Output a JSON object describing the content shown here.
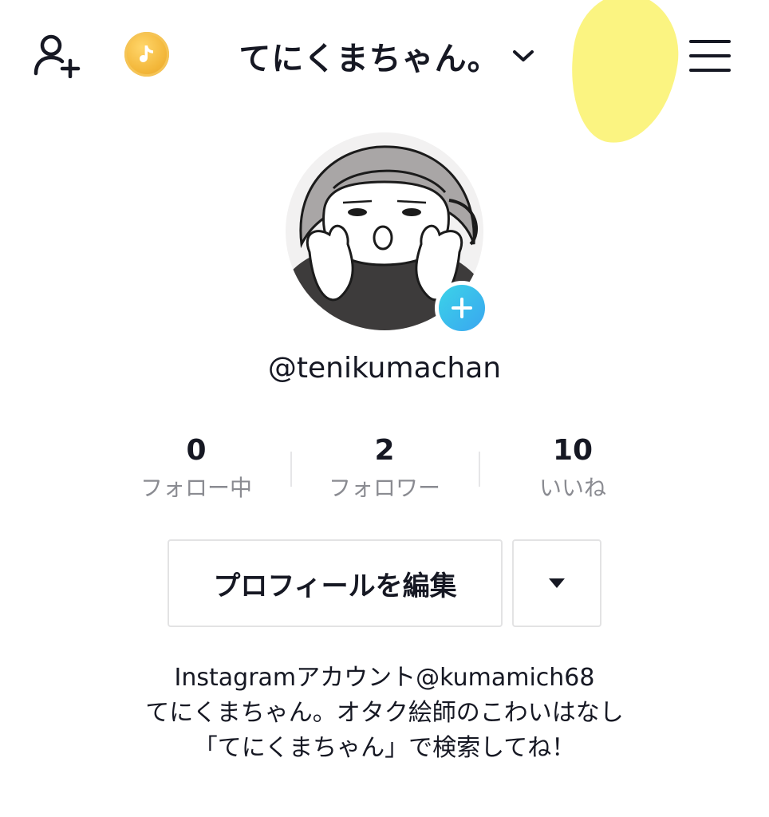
{
  "header": {
    "add_friend_icon": "add-friend-icon",
    "coin_icon": "tiktok-coin-icon",
    "account_name": "てにくまちゃん。",
    "switch_icon": "chevron-down-icon",
    "menu_icon": "hamburger-menu-icon"
  },
  "profile": {
    "avatar_icon": "avatar",
    "add_avatar_icon": "plus-icon",
    "username": "@tenikumachan"
  },
  "stats": [
    {
      "value": "0",
      "label": "フォロー中"
    },
    {
      "value": "2",
      "label": "フォロワー"
    },
    {
      "value": "10",
      "label": "いいね"
    }
  ],
  "actions": {
    "edit_profile_label": "プロフィールを編集",
    "more_icon": "caret-down-icon"
  },
  "bio": {
    "lines": [
      "Instagramアカウント@kumamich68",
      "てにくまちゃん。オタク絵師のこわいはなし",
      "「てにくまちゃん」で検索してね！"
    ]
  },
  "colors": {
    "text": "#161823",
    "muted": "#8a8b91",
    "border": "#e3e3e4",
    "highlight": "#fbf37a",
    "accent": "#3bb8ee",
    "coin": "#f3b73a"
  }
}
